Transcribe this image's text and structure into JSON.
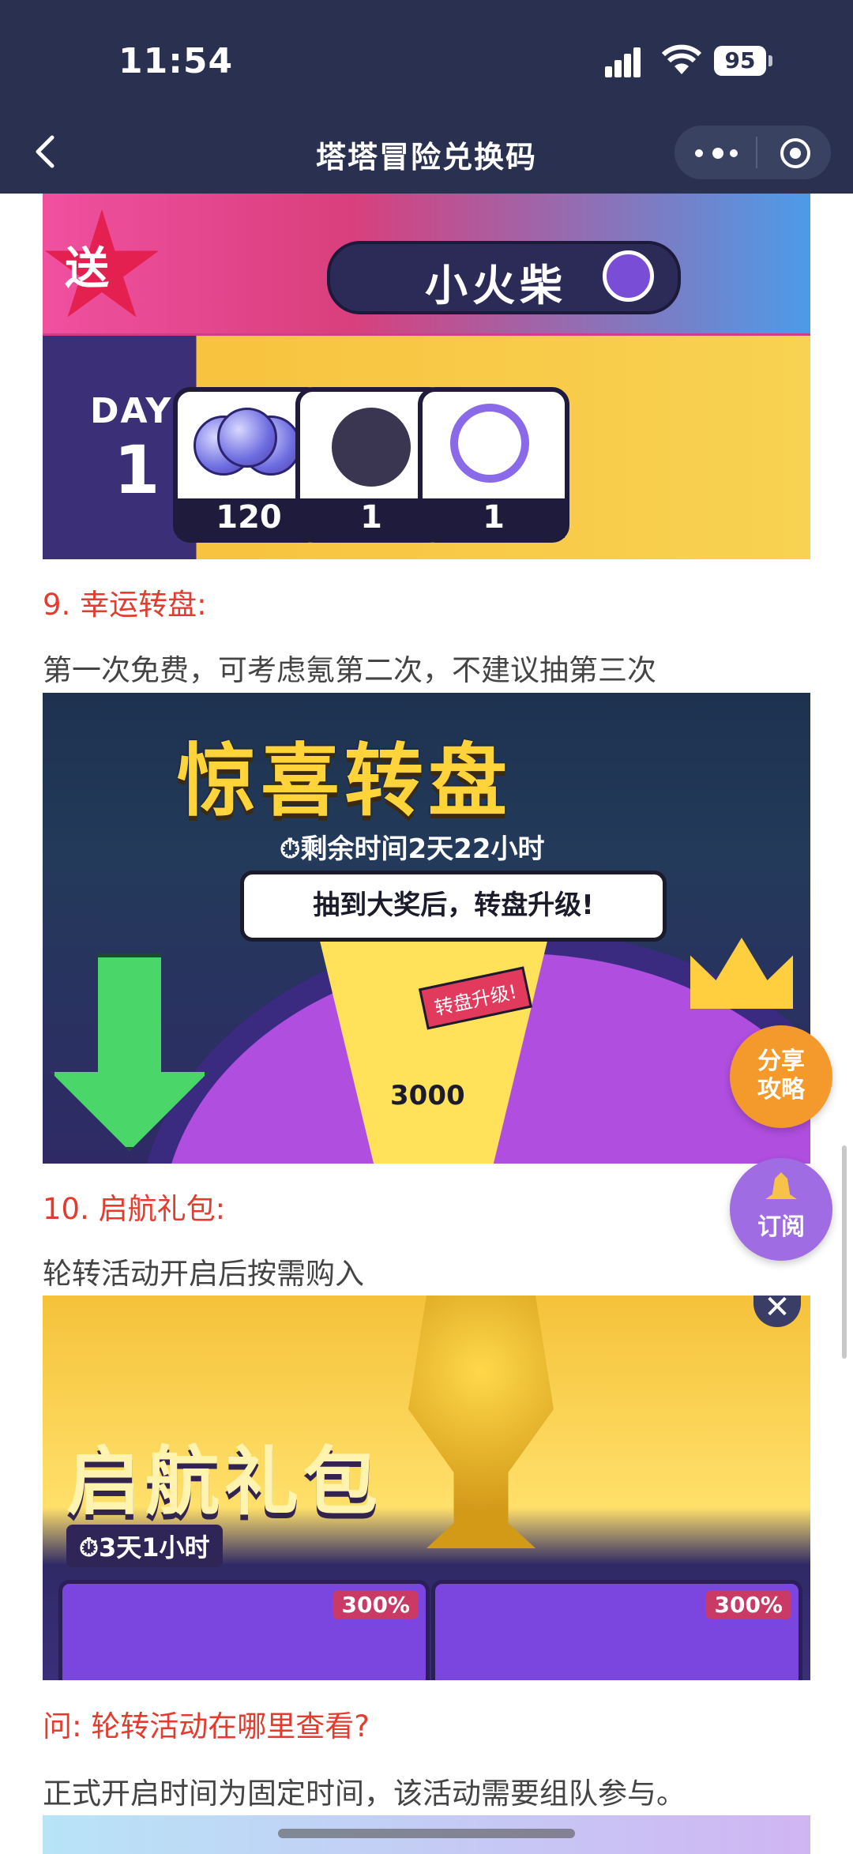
{
  "status_bar": {
    "time": "11:54",
    "battery": "95"
  },
  "nav": {
    "title": "塔塔冒险兑换码"
  },
  "image1": {
    "badge": "送",
    "search_text": "小火柴",
    "day_label": "DAY",
    "day_number": "1",
    "rewards": [
      "120",
      "1",
      "1"
    ]
  },
  "section9": {
    "heading": "9. 幸运转盘:",
    "text": "第一次免费，可考虑氪第二次，不建议抽第三次"
  },
  "image2": {
    "headline": "惊喜转盘",
    "timer": "⏱剩余时间2天22小时",
    "bubble": "抽到大奖后，转盘升级!",
    "tag": "转盘升级!",
    "value": "3000"
  },
  "section10": {
    "heading": "10. 启航礼包:",
    "text": "轮转活动开启后按需购入"
  },
  "image3": {
    "headline": "启航礼包",
    "timer": "⏱3天1小时",
    "close": "✕",
    "pct_left": "300%",
    "pct_right": "300%"
  },
  "question": {
    "heading": "问: 轮转活动在哪里查看?",
    "text": "正式开启时间为固定时间，该活动需要组队参与。"
  },
  "fab": {
    "share": "分享攻略",
    "share_line1": "分享",
    "share_line2": "攻略",
    "subscribe": "订阅"
  }
}
